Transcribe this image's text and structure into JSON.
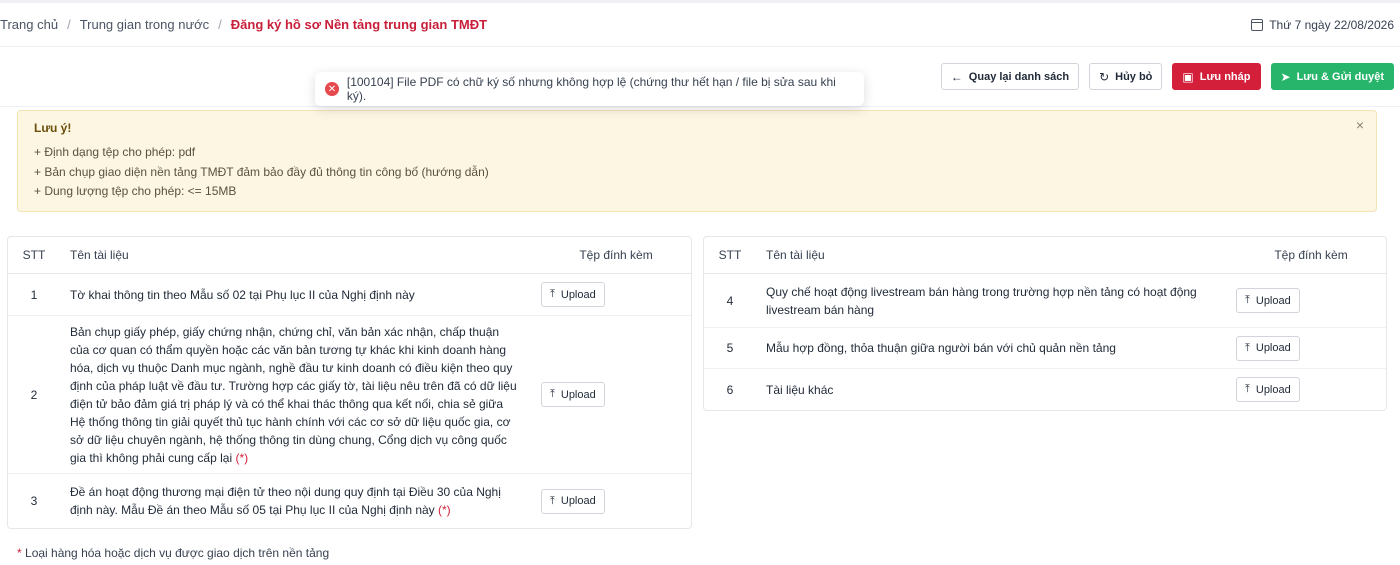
{
  "breadcrumb": {
    "home": "Trang chủ",
    "section": "Trung gian trong nước",
    "current": "Đăng ký hồ sơ Nền tảng trung gian TMĐT",
    "separator": "/"
  },
  "date": "Thứ 7 ngày 22/08/2026",
  "actions": {
    "back_label": "Quay lại danh sách",
    "cancel_label": "Hủy bỏ",
    "save_draft_label": "Lưu nháp",
    "save_submit_label": "Lưu & Gửi duyệt"
  },
  "toast": {
    "message": "[100104] File PDF có chữ ký số nhưng không hợp lệ (chứng thư hết hạn / file bị sửa sau khi ký)."
  },
  "notice": {
    "title": "Lưu ý!",
    "lines": [
      "+ Định dạng tệp cho phép: pdf",
      "+ Bản chụp giao diện nền tảng TMĐT đảm bảo đầy đủ thông tin công bố (hướng dẫn)",
      "+ Dung lượng tệp cho phép: <= 15MB"
    ],
    "close": "×"
  },
  "table_headers": {
    "stt": "STT",
    "name": "Tên tài liệu",
    "file": "Tệp đính kèm"
  },
  "upload_label": "Upload",
  "required_mark": "(*)",
  "left_rows": [
    {
      "stt": "1",
      "name": "Tờ khai thông tin theo Mẫu số 02 tại Phụ lục II của Nghị định này"
    },
    {
      "stt": "2",
      "name": "Bản chụp giấy phép, giấy chứng nhận, chứng chỉ, văn bản xác nhận, chấp thuận của cơ quan có thẩm quyền hoặc các văn bản tương tự khác khi kinh doanh hàng hóa, dịch vụ thuộc Danh mục ngành, nghề đầu tư kinh doanh có điều kiện theo quy định của pháp luật về đầu tư. Trường hợp các giấy tờ, tài liệu nêu trên đã có dữ liệu điện tử bảo đảm giá trị pháp lý và có thể khai thác thông qua kết nối, chia sẻ giữa Hệ thống thông tin giải quyết thủ tục hành chính với các cơ sở dữ liệu quốc gia, cơ sở dữ liệu chuyên ngành, hệ thống thông tin dùng chung, Cổng dịch vụ công quốc gia thì không phải cung cấp lại"
    },
    {
      "stt": "3",
      "name": "Đề án hoạt động thương mại điện tử theo nội dung quy định tại Điều 30 của Nghị định này. Mẫu Đề án theo Mẫu số 05 tại Phụ lục II của Nghị định này"
    }
  ],
  "right_rows": [
    {
      "stt": "4",
      "name": "Quy chế hoạt động livestream bán hàng trong trường hợp nền tảng có hoạt động livestream bán hàng"
    },
    {
      "stt": "5",
      "name": "Mẫu hợp đồng, thỏa thuận giữa người bán với chủ quản nền tảng"
    },
    {
      "stt": "6",
      "name": "Tài liệu khác"
    }
  ],
  "footnote": {
    "star": "*",
    "text": "Loại hàng hóa hoặc dịch vụ được giao dịch trên nền tảng"
  },
  "colors": {
    "brand_red": "#d41f3b",
    "accent_green": "#27b56b",
    "notice_bg": "#fdf6e2"
  }
}
